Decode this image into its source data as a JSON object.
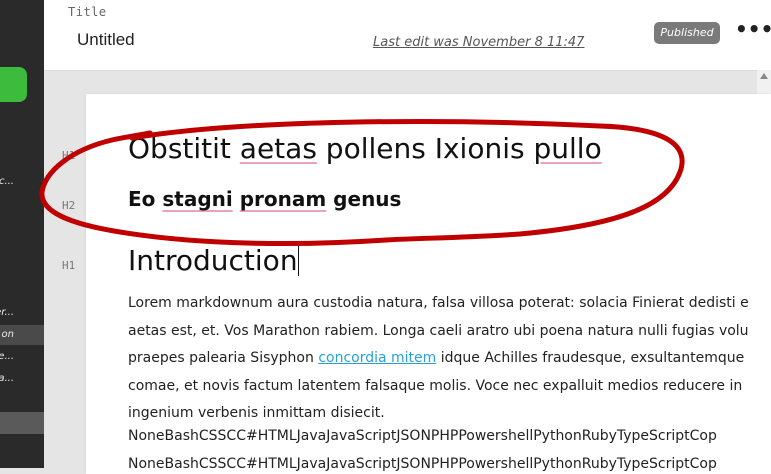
{
  "sidebar": {
    "items": [
      {
        "label": "c..."
      },
      {
        "label": "er..."
      },
      {
        "label": "on"
      },
      {
        "label": "te..."
      },
      {
        "label": "a..."
      }
    ]
  },
  "header": {
    "title_label": "Title",
    "title_value": "Untitled",
    "last_edit": "Last edit was November 8 11:47",
    "status_badge": "Published",
    "more_icon": "•••"
  },
  "gutter": {
    "tag1": "H1",
    "tag2": "H2",
    "tag3": "H1"
  },
  "editor": {
    "h1_parts": [
      "Obstitit ",
      "aetas",
      " pollens Ixionis ",
      "pullo"
    ],
    "h2_parts": [
      "Eo ",
      "stagni",
      " ",
      "pronam",
      " genus"
    ],
    "h1_intro": "Introduction",
    "para_lines": [
      "Lorem markdownum aura custodia natura, falsa villosa poterat: solacia Finierat dedisti e",
      "aetas est, et. Vos Marathon rabiem. Longa caeli aratro ubi poena natura nulli fugias volu"
    ],
    "line3_before": "praepes palearia Sisyphon ",
    "line3_link": "concordia mitem",
    "line3_after": " idque Achilles fraudesque, exsultantemque",
    "para_lines_rest": [
      "comae, et novis factum latentem falsaque molis. Voce nec expalluit medios reducere in",
      "ingenium verbenis inmittam disiecit."
    ],
    "langs_line1": "NoneBashCSSCC#HTMLJavaJavaScriptJSONPHPPowershellPythonRubyTypeScriptCop",
    "langs_line2": "NoneBashCSSCC#HTMLJavaJavaScriptJSONPHPPowershellPythonRubyTypeScriptCop"
  },
  "colors": {
    "sidebar_bg": "#2a2a2a",
    "accent_green": "#3dbb3d",
    "link": "#2aa0d8",
    "annotation_red": "#c00000",
    "badge_bg": "#7a7a7a"
  }
}
